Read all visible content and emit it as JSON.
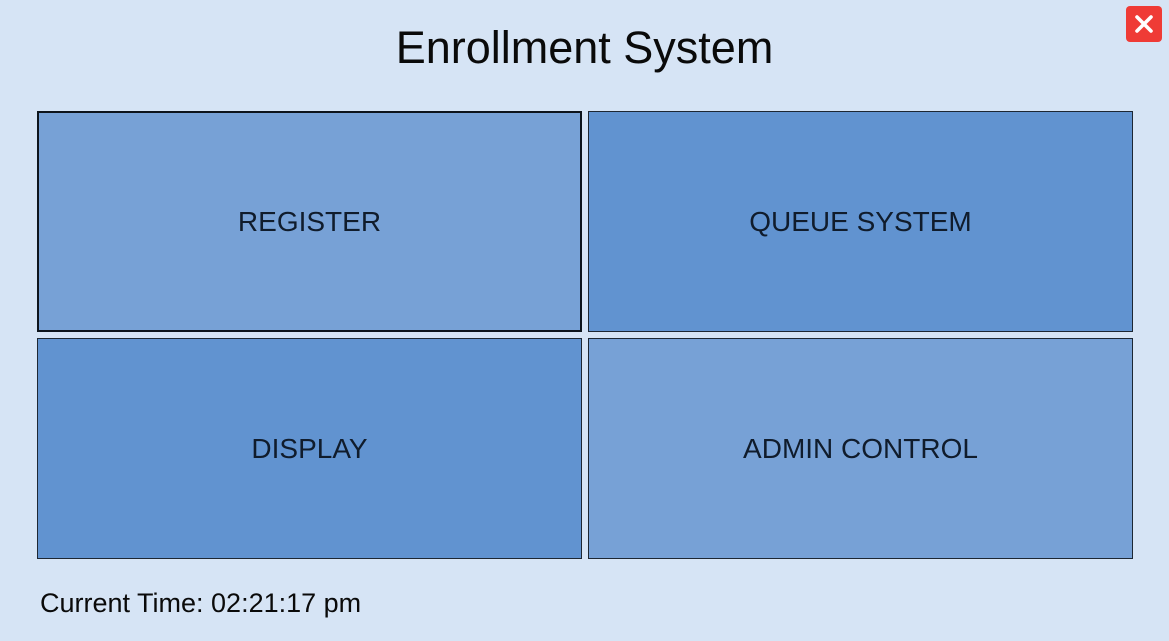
{
  "window": {
    "title": "Enrollment System",
    "close_icon": "close-icon",
    "close_color": "#ef3b36"
  },
  "menu": {
    "tiles": [
      {
        "label": "REGISTER",
        "color": "#77a1d6"
      },
      {
        "label": "QUEUE SYSTEM",
        "color": "#6193d0"
      },
      {
        "label": "DISPLAY",
        "color": "#6193d0"
      },
      {
        "label": "ADMIN CONTROL",
        "color": "#77a1d6"
      }
    ]
  },
  "footer": {
    "time_label": "Current Time: 02:21:17 pm"
  },
  "colors": {
    "background": "#d6e4f5"
  }
}
